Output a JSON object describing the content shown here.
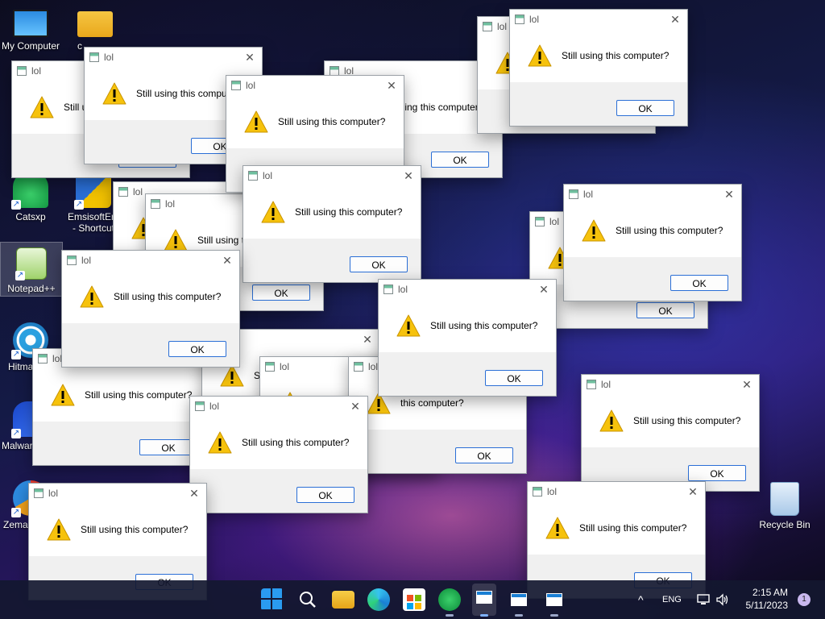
{
  "desktop": {
    "icons": {
      "my_computer": "My Computer",
      "catsxp": "Catsxp",
      "emsisoft_l1": "EmsisoftEm",
      "emsisoft_l2": "- Shortcut",
      "notepadpp": "Notepad++",
      "hitman": "Hitma",
      "malware": "Malwar",
      "zemana": "Zema",
      "recycle_bin": "Recycle Bin",
      "folder_partial": "c"
    }
  },
  "dialog": {
    "title": "lol",
    "message": "Still using this computer?",
    "message_partial_1": "Still u",
    "message_partial_2": "Still using t",
    "message_partial_3": "this computer?",
    "message_partial_4": "St",
    "message_partial_5": "computer?",
    "ok_label": "OK",
    "close_glyph": "✕"
  },
  "taskbar": {
    "language": "ENG",
    "time": "2:15 AM",
    "date": "5/11/2023",
    "notification_count": "1",
    "tray_chevron": "^"
  },
  "colors": {
    "accent": "#2b6fd6",
    "warning": "#f6c20c"
  }
}
